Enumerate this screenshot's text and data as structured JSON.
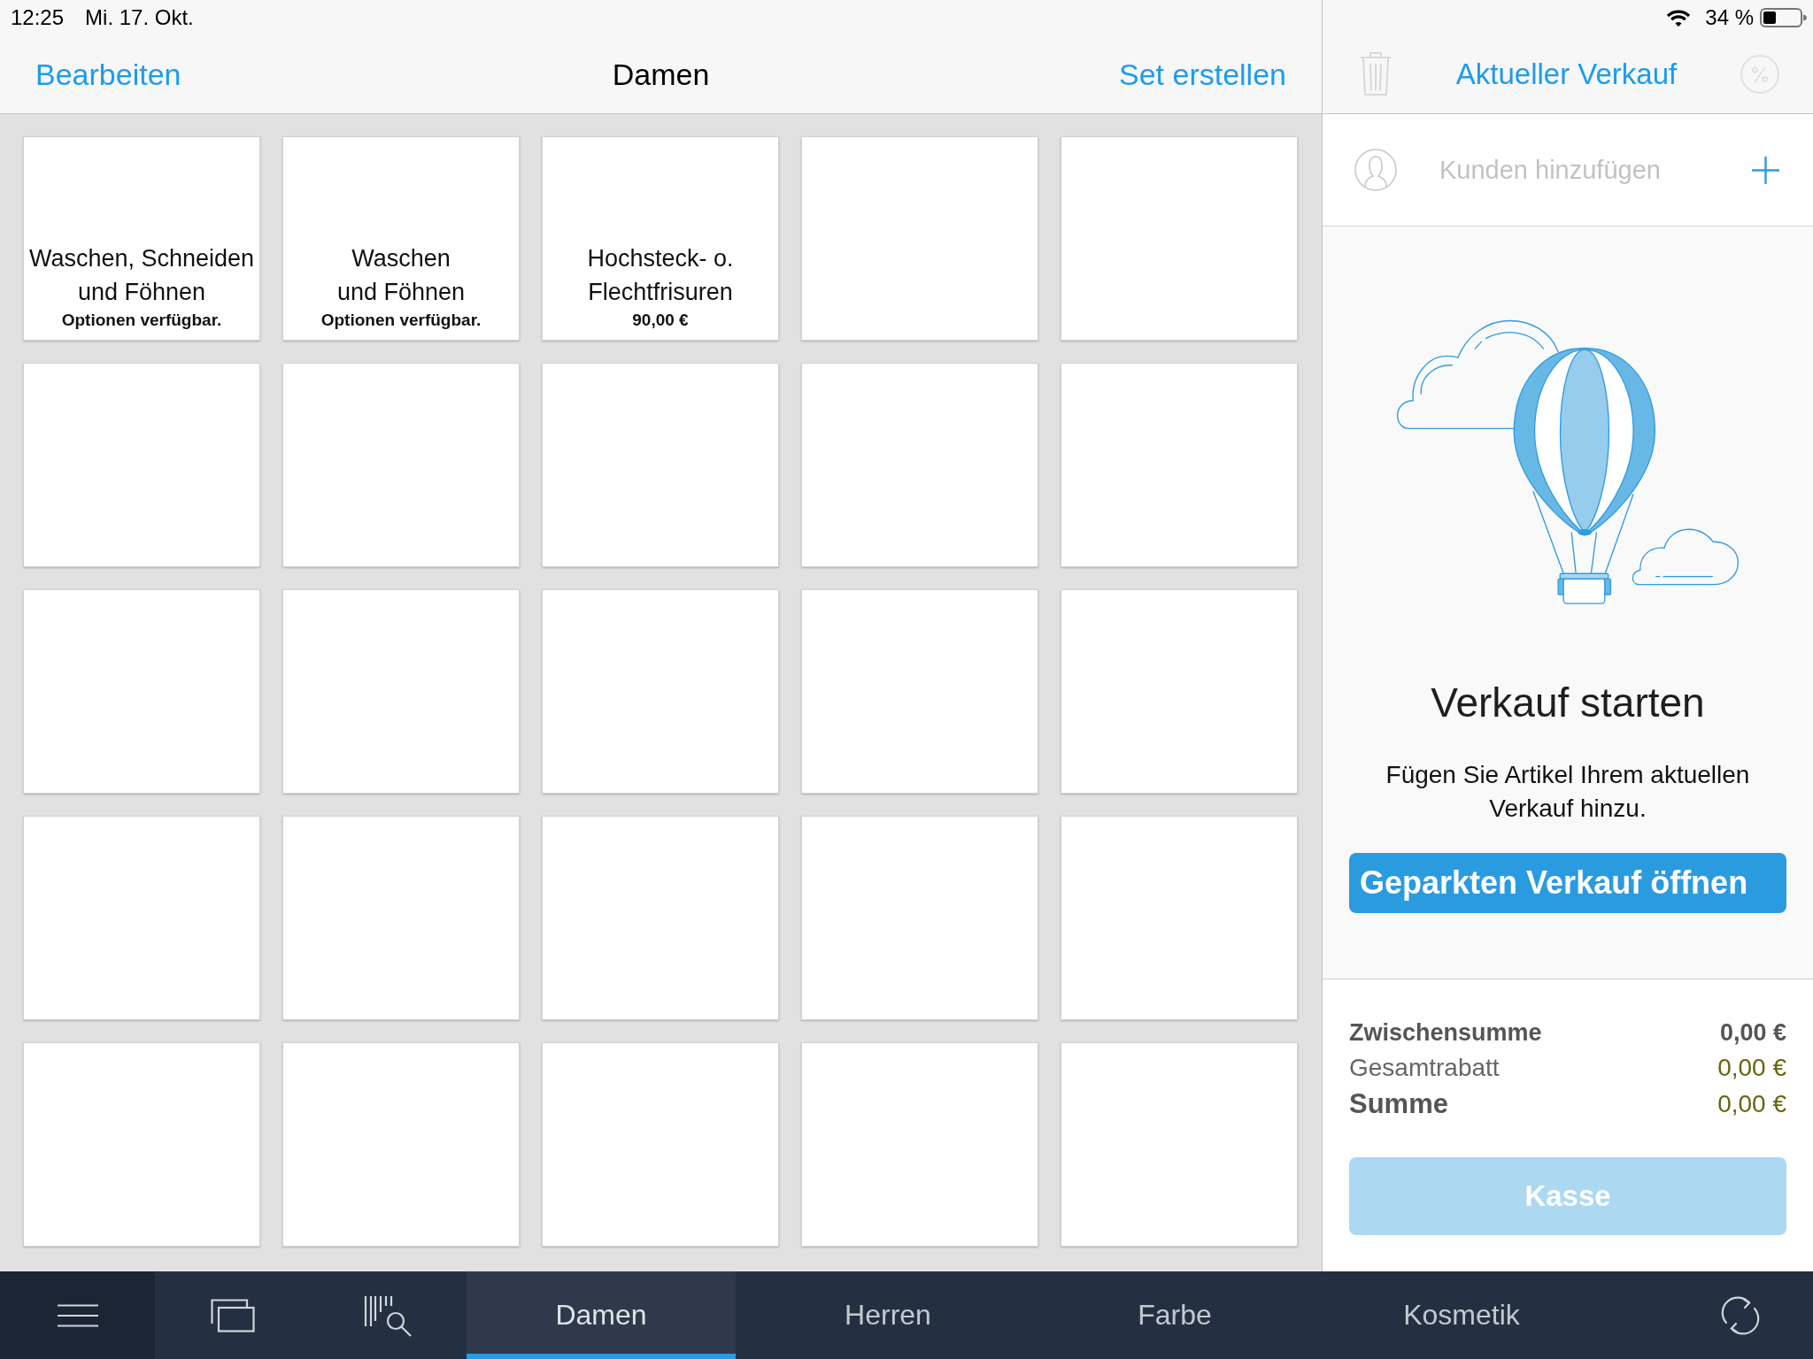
{
  "status_bar": {
    "time": "12:25",
    "date": "Mi. 17. Okt.",
    "battery": "34 %"
  },
  "catalog": {
    "nav": {
      "edit": "Bearbeiten",
      "title": "Damen",
      "create_set": "Set erstellen"
    },
    "tiles": [
      {
        "kind": "product",
        "name": "Waschen, Schneiden\nund Föhnen",
        "detail": "Optionen verfügbar."
      },
      {
        "kind": "product",
        "name": "Waschen\nund Föhnen",
        "detail": "Optionen verfügbar."
      },
      {
        "kind": "product",
        "name": "Hochsteck- o.\nFlechtfrisuren",
        "detail": "90,00 €"
      },
      {
        "kind": "empty"
      },
      {
        "kind": "empty"
      },
      {
        "kind": "empty"
      },
      {
        "kind": "empty"
      },
      {
        "kind": "empty"
      },
      {
        "kind": "empty"
      },
      {
        "kind": "empty"
      },
      {
        "kind": "empty"
      },
      {
        "kind": "empty"
      },
      {
        "kind": "empty"
      },
      {
        "kind": "empty"
      },
      {
        "kind": "empty"
      },
      {
        "kind": "empty"
      },
      {
        "kind": "empty"
      },
      {
        "kind": "empty"
      },
      {
        "kind": "empty"
      },
      {
        "kind": "empty"
      },
      {
        "kind": "empty"
      },
      {
        "kind": "empty"
      },
      {
        "kind": "empty"
      },
      {
        "kind": "empty"
      },
      {
        "kind": "empty"
      }
    ]
  },
  "sale_panel": {
    "trash_button": {
      "disabled": true
    },
    "title": "Aktueller Verkauf",
    "percent_button": {
      "disabled": true
    },
    "customer": {
      "label": "Kunden hinzufügen"
    },
    "empty_state": {
      "title": "Verkauf starten",
      "message": "Fügen Sie Artikel Ihrem aktuellen Verkauf hinzu.",
      "button": "Geparkten Verkauf öffnen"
    },
    "totals": [
      {
        "kind": "subtotal",
        "label": "Zwischensumme",
        "value": "0,00 €"
      },
      {
        "kind": "discount",
        "label": "Gesamtrabatt",
        "value": "0,00 €"
      },
      {
        "kind": "total",
        "label": "Summe",
        "value": "0,00 €"
      }
    ],
    "checkout": {
      "label": "Kasse",
      "disabled": true
    }
  },
  "tab_bar": {
    "tabs": [
      {
        "label": "Damen",
        "selected": true
      },
      {
        "label": "Herren",
        "selected": false
      },
      {
        "label": "Farbe",
        "selected": false
      },
      {
        "label": "Kosmetik",
        "selected": false
      }
    ]
  }
}
